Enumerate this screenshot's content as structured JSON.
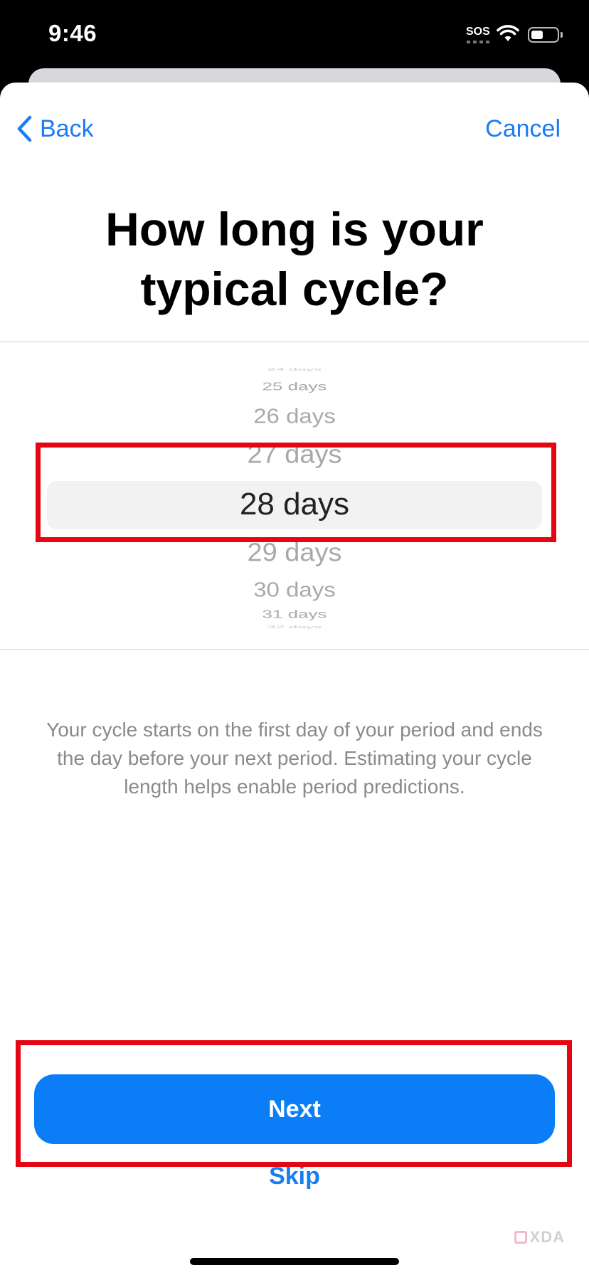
{
  "status_bar": {
    "time": "9:46",
    "sos": "SOS",
    "icons": [
      "wifi-icon",
      "battery-icon"
    ]
  },
  "nav": {
    "back_label": "Back",
    "cancel_label": "Cancel",
    "accent_color": "#1a7cf3"
  },
  "title": {
    "line1": "How long is your",
    "line2": "typical cycle?"
  },
  "picker": {
    "items": [
      "24 days",
      "25 days",
      "26 days",
      "27 days",
      "28 days",
      "29 days",
      "30 days",
      "31 days",
      "32 days"
    ],
    "selected": "28 days"
  },
  "description": "Your cycle starts on the first day of your period and ends the day before your next period. Estimating your cycle length helps enable period predictions.",
  "actions": {
    "next_label": "Next",
    "skip_label": "Skip",
    "button_color": "#0a7df7"
  },
  "highlight_color": "#e40613",
  "watermark": "XDA"
}
